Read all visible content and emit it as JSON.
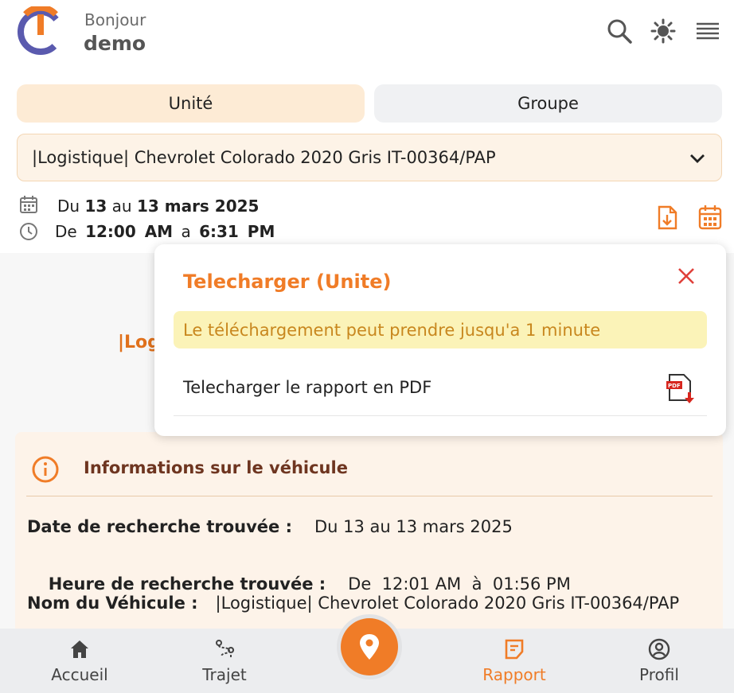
{
  "header": {
    "greeting": "Bonjour",
    "username": "demo"
  },
  "tabs": [
    {
      "label": "Unité",
      "active": true
    },
    {
      "label": "Groupe",
      "active": false
    }
  ],
  "vehicle_select": {
    "value": "|Logistique| Chevrolet Colorado 2020 Gris IT-00364/PAP"
  },
  "date_range": {
    "du": "Du",
    "from": "13",
    "au": "au",
    "to": "13 mars 2025"
  },
  "time_range": {
    "de": "De",
    "from": "12:00 AM",
    "a": "a",
    "to": "6:31 PM"
  },
  "popup": {
    "title": "Telecharger (Unite)",
    "warning": "Le téléchargement peut prendre jusqu'a 1 minute",
    "pdf_label": "Telecharger le rapport en PDF"
  },
  "behind_text": "|Log",
  "info": {
    "title": "Informations sur le véhicule",
    "rows": [
      {
        "label": "Date de recherche trouvée :",
        "value": "Du 13 au 13 mars 2025"
      },
      {
        "label": "Heure de recherche trouvée :",
        "value": "De  12:01 AM  à  01:56 PM"
      },
      {
        "label": "Nom du Véhicule :",
        "value": "|Logistique| Chevrolet Colorado 2020 Gris IT-00364/PAP"
      }
    ]
  },
  "nav": {
    "home": "Accueil",
    "trajet": "Trajet",
    "rapport": "Rapport",
    "profil": "Profil"
  },
  "colors": {
    "accent": "#f07c27",
    "close": "#e0403a",
    "tab_active": "#fdebd5"
  }
}
